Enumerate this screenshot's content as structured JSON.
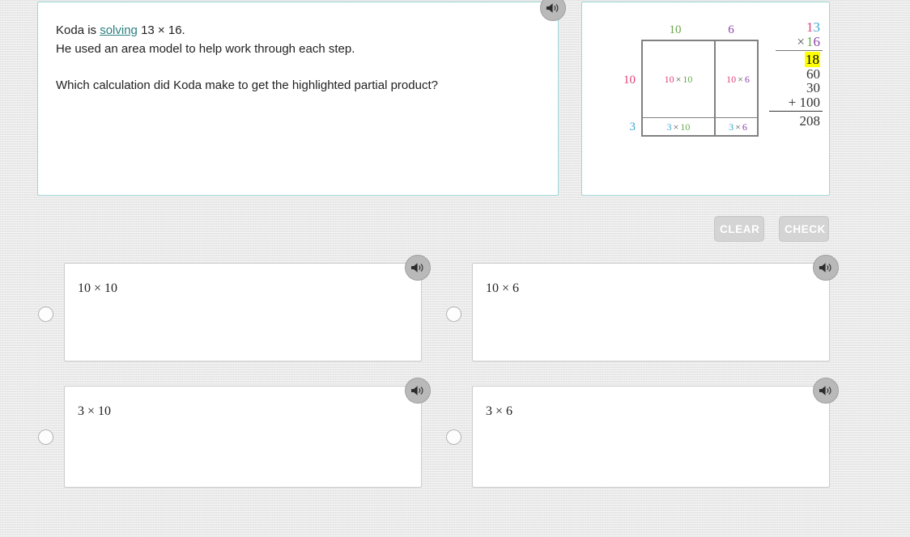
{
  "question": {
    "line1_pre": "Koda is ",
    "line1_link": "solving",
    "line1_post": " 13 × 16.",
    "line2": "He used an area model to help work through each step.",
    "line3": "Which calculation did Koda make to get the highlighted partial product?",
    "speaker_icon": "speaker-icon"
  },
  "figure": {
    "area_model": {
      "col_headers": [
        "10",
        "6"
      ],
      "row_headers": [
        "10",
        "3"
      ],
      "cells": [
        {
          "id": "cell-tl",
          "left": "10",
          "op": "×",
          "right": "10"
        },
        {
          "id": "cell-tr",
          "left": "10",
          "op": "×",
          "right": "6"
        },
        {
          "id": "cell-bl",
          "left": "3",
          "op": "×",
          "right": "10"
        },
        {
          "id": "cell-br",
          "left": "3",
          "op": "×",
          "right": "6"
        }
      ]
    },
    "vertical_calc": {
      "multiplicand_tens": "1",
      "multiplicand_ones": "3",
      "operator": "×",
      "multiplier_tens": "1",
      "multiplier_ones": "6",
      "partials": [
        "18",
        "60",
        "30"
      ],
      "last_partial_sign": "+ ",
      "last_partial": "100",
      "total": "208",
      "highlighted_partial": "18"
    }
  },
  "colors": {
    "row_10": "#e0427a",
    "row_3": "#3aa8cf",
    "col_10": "#6aa84f",
    "col_6": "#8e44ad",
    "highlight": "#ffff00",
    "link": "#2d7f7f",
    "panel_border": "#9fd8d8"
  },
  "toolbar": {
    "clear_label": "CLEAR",
    "check_label": "CHECK"
  },
  "options": [
    {
      "id": "a",
      "label": "10 × 10",
      "speaker_icon": "speaker-icon",
      "selected": false
    },
    {
      "id": "b",
      "label": "10 × 6",
      "speaker_icon": "speaker-icon",
      "selected": false
    },
    {
      "id": "c",
      "label": "3 × 10",
      "speaker_icon": "speaker-icon",
      "selected": false
    },
    {
      "id": "d",
      "label": "3 × 6",
      "speaker_icon": "speaker-icon",
      "selected": false
    }
  ]
}
